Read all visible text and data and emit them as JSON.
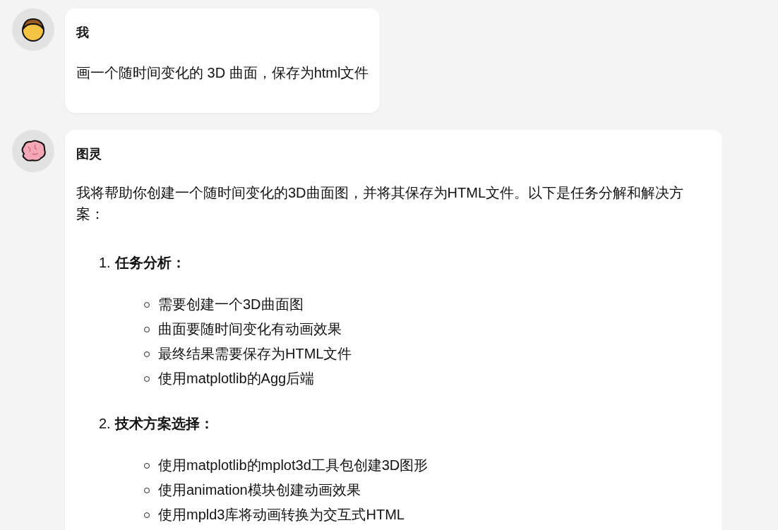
{
  "messages": [
    {
      "kind": "user",
      "author": "我",
      "text": "画一个随时间变化的 3D 曲面，保存为html文件"
    },
    {
      "kind": "assistant",
      "author": "图灵",
      "intro": "我将帮助你创建一个随时间变化的3D曲面图，并将其保存为HTML文件。以下是任务分解和解决方案：",
      "sections": [
        {
          "number": "1.",
          "title": "任务分析：",
          "items": [
            "需要创建一个3D曲面图",
            "曲面要随时间变化有动画效果",
            "最终结果需要保存为HTML文件",
            "使用matplotlib的Agg后端"
          ]
        },
        {
          "number": "2.",
          "title": "技术方案选择：",
          "items": [
            "使用matplotlib的mplot3d工具包创建3D图形",
            "使用animation模块创建动画效果",
            "使用mpld3库将动画转换为交互式HTML"
          ]
        }
      ]
    }
  ]
}
